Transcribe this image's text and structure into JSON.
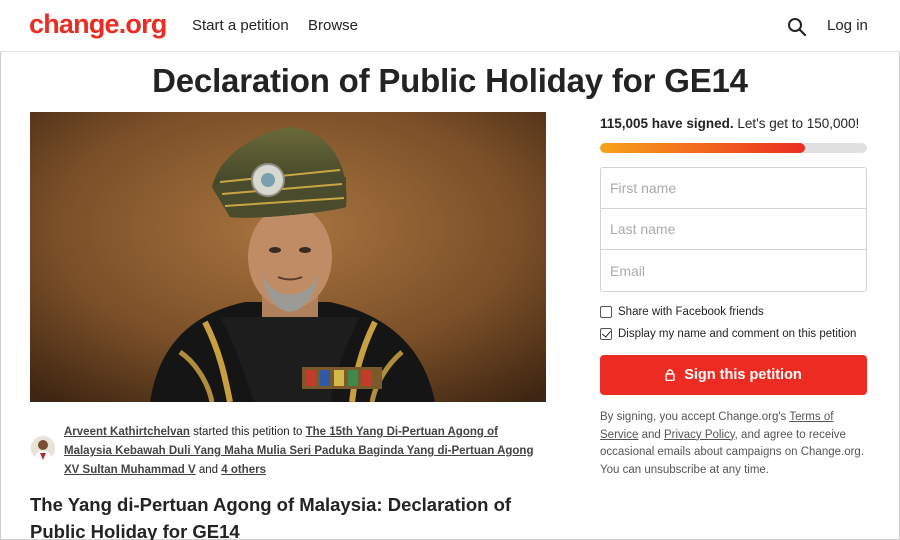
{
  "header": {
    "logo": "change.org",
    "nav": {
      "start": "Start a petition",
      "browse": "Browse"
    },
    "search_icon": "search-icon",
    "login": "Log in"
  },
  "petition": {
    "title": "Declaration of Public Holiday for GE14",
    "starter": {
      "name": "Arveent Kathirtchelvan",
      "started_text": "started this petition to",
      "recipient": "The 15th Yang Di-Pertuan Agong of Malaysia Kebawah Duli Yang Maha Mulia Seri Paduka Baginda Yang di-Pertuan Agong XV Sultan Muhammad V",
      "and_text": "and",
      "others": "4 others"
    },
    "body_heading": "The Yang di-Pertuan Agong of Malaysia: Declaration of Public Holiday for GE14"
  },
  "signatures": {
    "count_text": "115,005 have signed.",
    "goal_text": "Let's get to 150,000!",
    "progress_fraction": 0.7667
  },
  "form": {
    "first_name_placeholder": "First name",
    "last_name_placeholder": "Last name",
    "email_placeholder": "Email",
    "share_facebook_label": "Share with Facebook friends",
    "share_facebook_checked": false,
    "display_name_label": "Display my name and comment on this petition",
    "display_name_checked": true,
    "sign_button": "Sign this petition"
  },
  "disclaimer": {
    "prefix": "By signing, you accept Change.org's",
    "terms": "Terms of Service",
    "and": "and",
    "privacy": "Privacy Policy",
    "suffix": ", and agree to receive occasional emails about campaigns on Change.org. You can unsubscribe at any time."
  },
  "colors": {
    "brand": "#ec2c22",
    "progress_start": "#f7a31a",
    "progress_end": "#ec2c22"
  }
}
